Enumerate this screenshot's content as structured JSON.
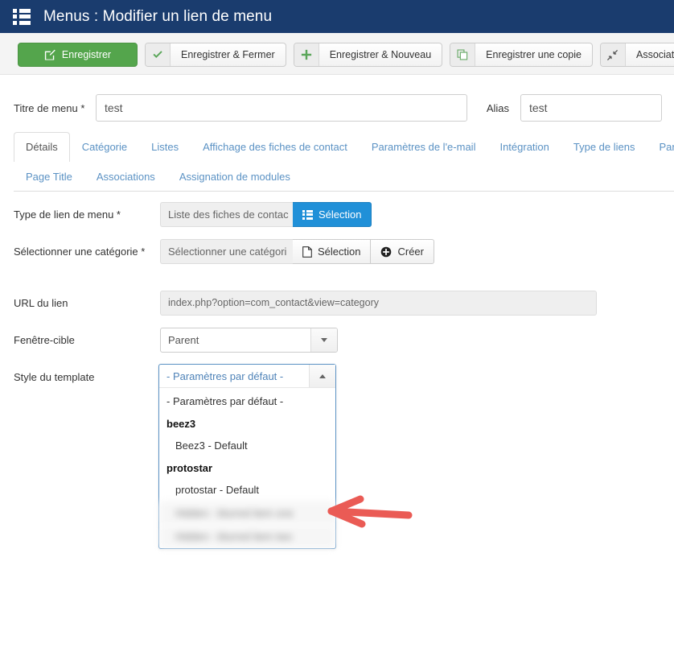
{
  "header": {
    "title": "Menus : Modifier un lien de menu",
    "icon": "menu-grid-icon",
    "bg_color": "#1a3c6e"
  },
  "toolbar": {
    "buttons": [
      {
        "label": "Enregistrer",
        "icon": "save-pencil-icon",
        "style": "primary",
        "color": "#54a54c"
      },
      {
        "label": "Enregistrer & Fermer",
        "icon": "check-icon",
        "style": "default"
      },
      {
        "label": "Enregistrer & Nouveau",
        "icon": "plus-icon",
        "style": "default"
      },
      {
        "label": "Enregistrer une copie",
        "icon": "copy-icon",
        "style": "default"
      },
      {
        "label": "Associations",
        "icon": "arrows-collapse-icon",
        "style": "default"
      }
    ]
  },
  "title_row": {
    "menu_title_label": "Titre de menu *",
    "menu_title_value": "test",
    "menu_title_placeholder": "",
    "alias_label": "Alias",
    "alias_value": "test",
    "alias_placeholder": ""
  },
  "tabs": {
    "row1": [
      {
        "label": "Détails",
        "active": true
      },
      {
        "label": "Catégorie",
        "active": false
      },
      {
        "label": "Listes",
        "active": false
      },
      {
        "label": "Affichage des fiches de contact",
        "active": false
      },
      {
        "label": "Paramètres de l'e-mail",
        "active": false
      },
      {
        "label": "Intégration",
        "active": false
      },
      {
        "label": "Type de liens",
        "active": false
      },
      {
        "label": "Param",
        "active": false
      }
    ],
    "row2": [
      {
        "label": "Page Title",
        "active": false
      },
      {
        "label": "Associations",
        "active": false
      },
      {
        "label": "Assignation de modules",
        "active": false
      }
    ]
  },
  "fields": {
    "menu_link_type": {
      "label": "Type de lien de menu *",
      "value": "Liste des fiches de contac",
      "button_label": "Sélection",
      "button_icon": "list-grid-icon",
      "button_color": "#2090d8"
    },
    "category": {
      "label": "Sélectionner une catégorie *",
      "value": "Sélectionner une catégori",
      "select_label": "Sélection",
      "select_icon": "document-icon",
      "create_label": "Créer",
      "create_icon": "plus-circle-icon"
    },
    "link_url": {
      "label": "URL du lien",
      "value": "index.php?option=com_contact&view=category"
    },
    "target_window": {
      "label": "Fenêtre-cible",
      "value": "Parent",
      "caret_icon": "chevron-down-icon"
    },
    "template_style": {
      "label": "Style du template",
      "selected_value": "- Paramètres par défaut -",
      "caret_icon": "chevron-up-icon",
      "expanded": true,
      "options": [
        {
          "label": "- Paramètres par défaut -",
          "type": "option"
        },
        {
          "label": "beez3",
          "type": "group"
        },
        {
          "label": "Beez3 - Default",
          "type": "option"
        },
        {
          "label": "protostar",
          "type": "group"
        },
        {
          "label": "protostar - Default",
          "type": "option"
        },
        {
          "label": "Hidden - blurred item one",
          "type": "blurred"
        },
        {
          "label": "Hidden - blurred item two",
          "type": "blurred"
        }
      ]
    }
  },
  "annotation": {
    "arrow": "red-left-arrow",
    "color": "#ea5b55"
  }
}
